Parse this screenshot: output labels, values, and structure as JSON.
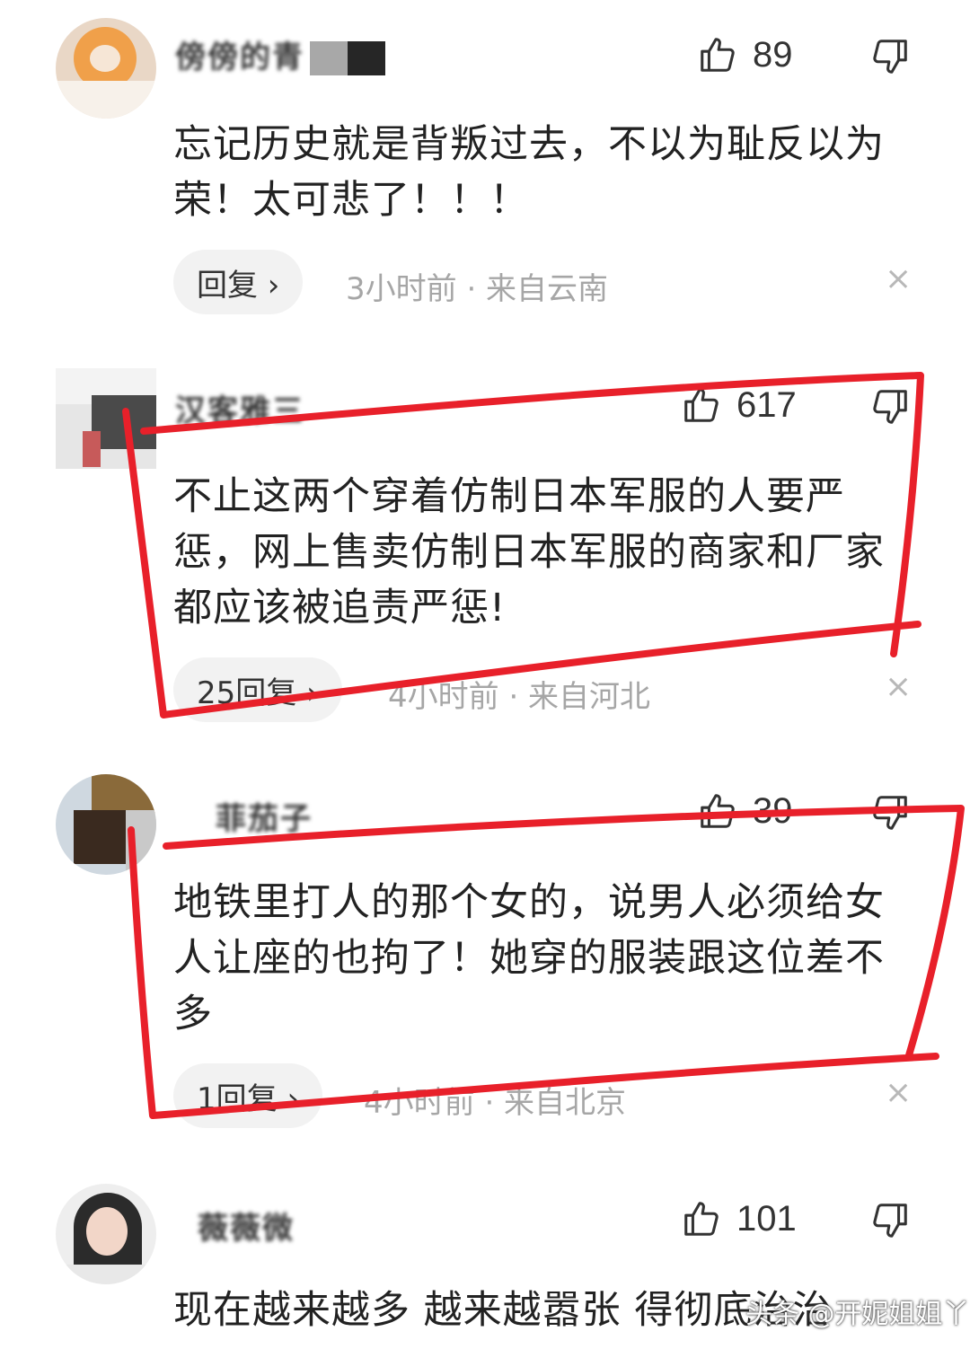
{
  "comments": [
    {
      "username": "傍傍的青",
      "likes": "89",
      "text": "忘记历史就是背叛过去，不以为耻反以为荣！太可悲了！！！",
      "reply_label": "回复 ›",
      "meta": "3小时前 · 来自云南"
    },
    {
      "username": "汉客雅三",
      "likes": "617",
      "text": "不止这两个穿着仿制日本军服的人要严惩，网上售卖仿制日本军服的商家和厂家都应该被追责严惩!",
      "reply_label": "25回复 ›",
      "meta": "4小时前 · 来自河北"
    },
    {
      "username": "菲茄子",
      "likes": "39",
      "text": "地铁里打人的那个女的，说男人必须给女人让座的也拘了！她穿的服装跟这位差不多",
      "reply_label": "1回复 ›",
      "meta": "4小时前 · 来自北京"
    },
    {
      "username": "薇薇微",
      "likes": "101",
      "text": "现在越来越多 越来越嚣张 得彻底治治"
    }
  ],
  "close_glyph": "×",
  "watermark": "头条 @开妮姐姐丫",
  "colors": {
    "highlight": "#e8202a",
    "meta": "#a6a6a6",
    "pill": "#f2f2f2"
  }
}
